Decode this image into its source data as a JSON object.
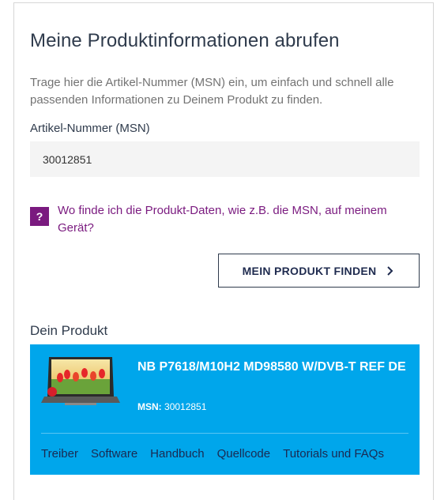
{
  "page": {
    "title": "Meine Produktinformationen abrufen",
    "description": "Trage hier die Artikel-Nummer (MSN) ein, um einfach und schnell alle passenden Informationen zu Deinem Produkt zu finden."
  },
  "form": {
    "field_label": "Artikel-Nummer (MSN)",
    "msn_value": "30012851",
    "help_icon": "?",
    "help_link": "Wo finde ich die Produkt-Daten, wie z.B. die MSN, auf meinem Gerät?",
    "find_button": "MEIN PRODUKT FINDEN"
  },
  "product": {
    "section_title": "Dein Produkt",
    "name": "NB P7618/M10H2 MD98580 W/DVB-T REF DE",
    "msn_label": "MSN:",
    "msn_value": "30012851",
    "image_icon": "laptop-image",
    "links": [
      "Treiber",
      "Software",
      "Handbuch",
      "Quellcode",
      "Tutorials und FAQs"
    ]
  },
  "colors": {
    "accent_purple": "#7a1a7f",
    "product_box": "#00a6eb",
    "dark_navy": "#1f2b4f"
  }
}
